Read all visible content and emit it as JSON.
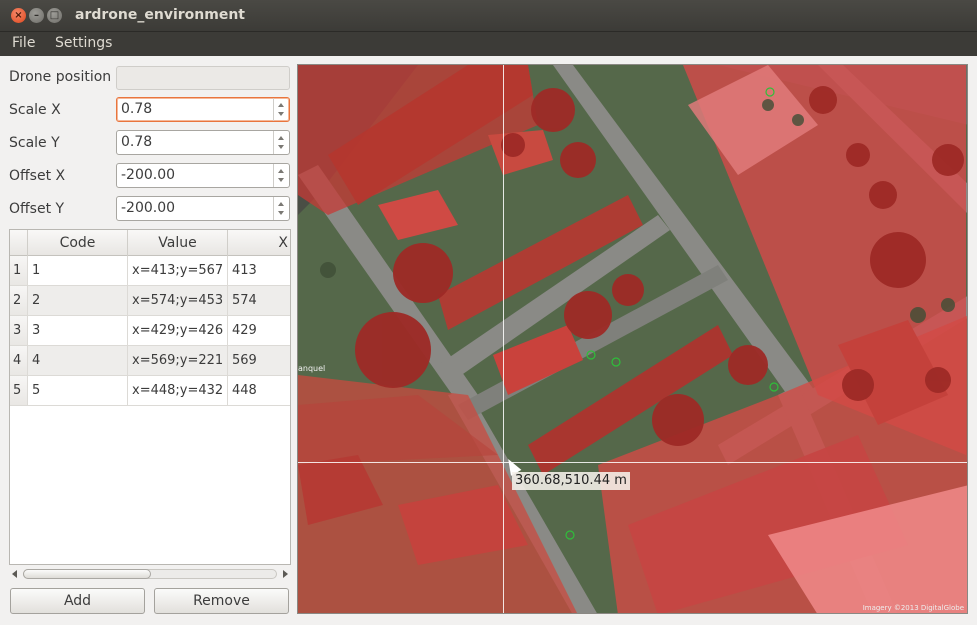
{
  "window": {
    "title": "ardrone_environment"
  },
  "menubar": {
    "file": "File",
    "settings": "Settings"
  },
  "form": {
    "drone_position_label": "Drone position",
    "drone_position_value": "",
    "scale_x_label": "Scale X",
    "scale_x_value": "0.78",
    "scale_y_label": "Scale Y",
    "scale_y_value": "0.78",
    "offset_x_label": "Offset X",
    "offset_x_value": "-200.00",
    "offset_y_label": "Offset Y",
    "offset_y_value": "-200.00"
  },
  "table": {
    "headers": [
      "Code",
      "Value",
      "X"
    ],
    "rows": [
      {
        "num": "1",
        "code": "1",
        "value": "x=413;y=567",
        "x": "413"
      },
      {
        "num": "2",
        "code": "2",
        "value": "x=574;y=453",
        "x": "574"
      },
      {
        "num": "3",
        "code": "3",
        "value": "x=429;y=426",
        "x": "429"
      },
      {
        "num": "4",
        "code": "4",
        "value": "x=569;y=221",
        "x": "569"
      },
      {
        "num": "5",
        "code": "5",
        "value": "x=448;y=432",
        "x": "448"
      }
    ]
  },
  "buttons": {
    "add": "Add",
    "remove": "Remove"
  },
  "map": {
    "coord_readout": "360.68,510.44 m",
    "copyright": "Imagery ©2013 DigitalGlobe",
    "street_label": "anquel",
    "colors": {
      "overlay": "#d62b2b",
      "grass": "#5f7d4a",
      "road": "#8a8a86"
    }
  }
}
